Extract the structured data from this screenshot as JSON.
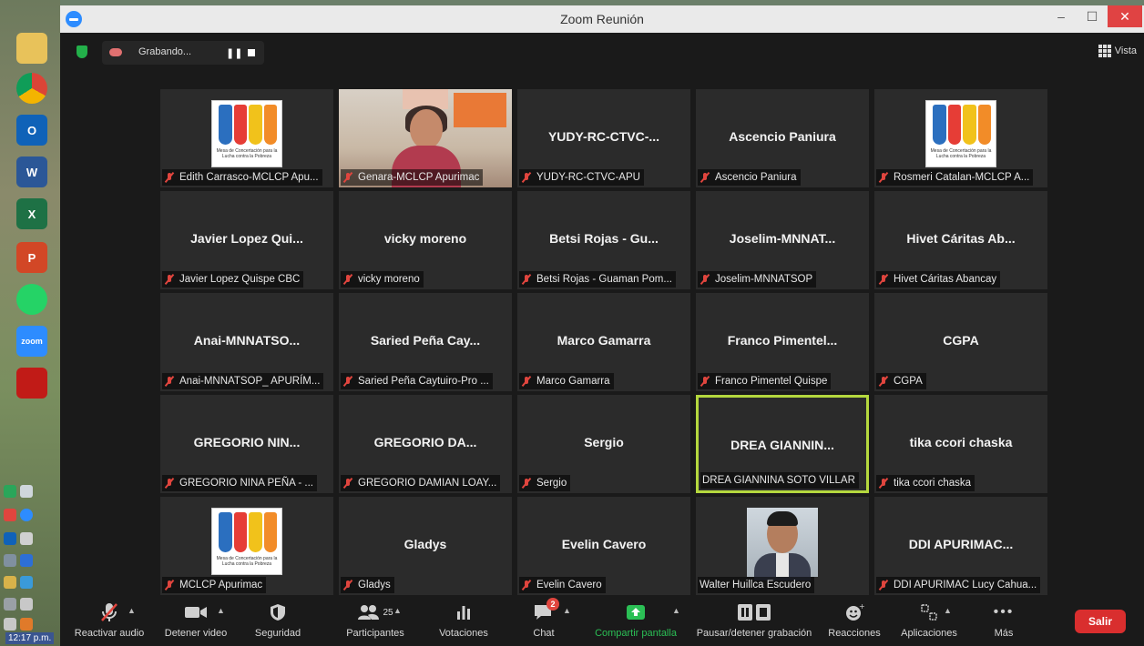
{
  "window": {
    "title": "Zoom Reunión",
    "minimize": "–",
    "maximize": "☐",
    "close": "✕"
  },
  "recording": {
    "label": "Grabando...",
    "pause": "❚❚"
  },
  "view": {
    "label": "Vista"
  },
  "taskbar": {
    "clock": "12:17 p.m.",
    "outlook": "O",
    "word": "W",
    "excel": "X",
    "powerpoint": "P",
    "zoom": "zoom"
  },
  "tiles": [
    {
      "title": "",
      "name": "Edith Carrasco-MCLCP Apu...",
      "logo": true
    },
    {
      "title": "",
      "name": "Genara-MCLCP Apurimac",
      "photo": "woman"
    },
    {
      "title": "YUDY-RC-CTVC-...",
      "name": "YUDY-RC-CTVC-APU"
    },
    {
      "title": "Ascencio Paniura",
      "name": "Ascencio Paniura"
    },
    {
      "title": "",
      "name": "Rosmeri Catalan-MCLCP A...",
      "logo": true
    },
    {
      "title": "Javier Lopez Qui...",
      "name": "Javier Lopez Quispe CBC"
    },
    {
      "title": "vicky moreno",
      "name": "vicky moreno"
    },
    {
      "title": "Betsi Rojas - Gu...",
      "name": "Betsi Rojas - Guaman Pom..."
    },
    {
      "title": "Joselim-MNNAT...",
      "name": "Joselim-MNNATSOP"
    },
    {
      "title": "Hivet Cáritas Ab...",
      "name": "Hivet Cáritas Abancay"
    },
    {
      "title": "Anai-MNNATSO...",
      "name": "Anai-MNNATSOP_ APURÍM..."
    },
    {
      "title": "Saried Peña Cay...",
      "name": "Saried Peña Caytuiro-Pro ..."
    },
    {
      "title": "Marco Gamarra",
      "name": "Marco Gamarra"
    },
    {
      "title": "Franco Pimentel...",
      "name": "Franco Pimentel Quispe"
    },
    {
      "title": "CGPA",
      "name": "CGPA"
    },
    {
      "title": "GREGORIO NIN...",
      "name": "GREGORIO NINA PEÑA - ..."
    },
    {
      "title": "GREGORIO DA...",
      "name": "GREGORIO DAMIAN LOAY..."
    },
    {
      "title": "Sergio",
      "name": "Sergio"
    },
    {
      "title": "DREA GIANNIN...",
      "name": "DREA GIANNINA SOTO VILLAR",
      "active": true,
      "muted": false
    },
    {
      "title": "tika ccori chaska",
      "name": "tika ccori chaska"
    },
    {
      "title": "",
      "name": "MCLCP Apurimac",
      "logo": true
    },
    {
      "title": "Gladys",
      "name": "Gladys"
    },
    {
      "title": "Evelin Cavero",
      "name": "Evelin Cavero"
    },
    {
      "title": "",
      "name": "Walter Huillca Escudero",
      "photo": "man",
      "muted": false
    },
    {
      "title": "DDI APURIMAC...",
      "name": "DDI APURIMAC Lucy Cahua..."
    }
  ],
  "logo_text": "Mesa de Concertación para la Lucha contra la Pobreza",
  "logo_colors": [
    "#2b6fbf",
    "#e63d36",
    "#f1c21b",
    "#f28c28"
  ],
  "toolbar": {
    "audio": "Reactivar audio",
    "video": "Detener video",
    "security": "Seguridad",
    "participants": "Participantes",
    "participants_count": "25",
    "polls": "Votaciones",
    "chat": "Chat",
    "chat_badge": "2",
    "share": "Compartir pantalla",
    "record": "Pausar/detener grabación",
    "reactions": "Reacciones",
    "apps": "Aplicaciones",
    "more": "Más",
    "leave": "Salir"
  },
  "colors": {
    "active_speaker": "#b5d83e",
    "leave": "#d92e2e",
    "share": "#2bbf55",
    "muted": "#e0453e"
  }
}
